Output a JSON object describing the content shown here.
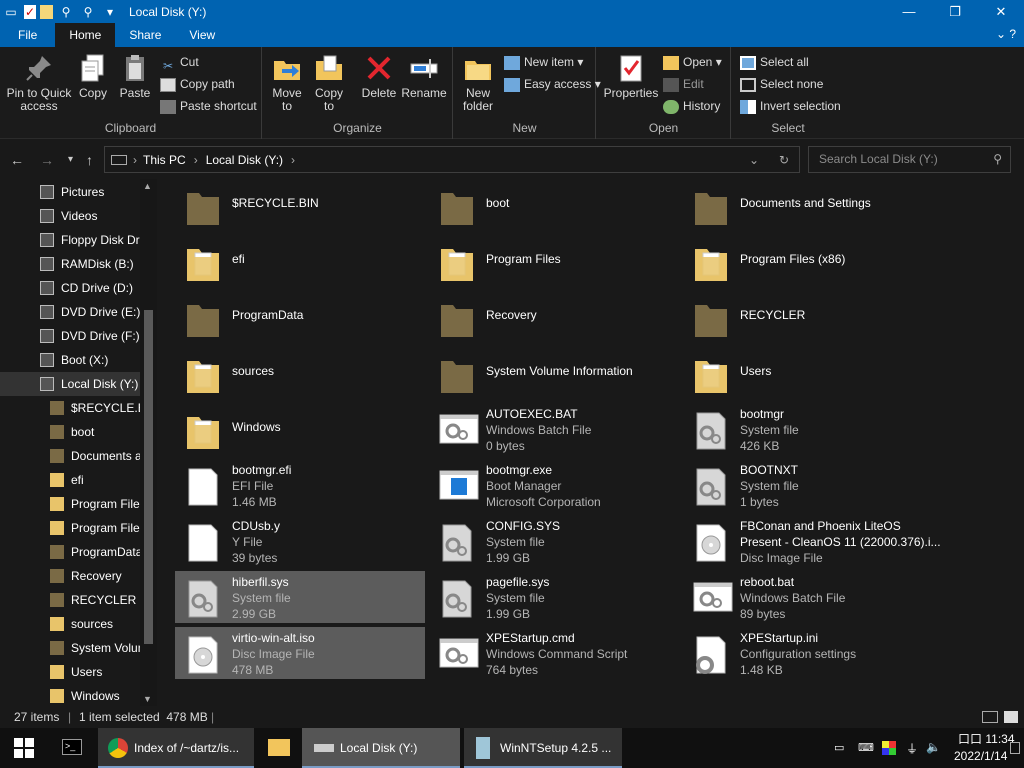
{
  "window": {
    "title": "Local Disk (Y:)"
  },
  "menu": {
    "file": "File",
    "home": "Home",
    "share": "Share",
    "view": "View"
  },
  "ribbon": {
    "clipboard": {
      "label": "Clipboard",
      "pin": "Pin to Quick access",
      "copy": "Copy",
      "paste": "Paste",
      "cut": "Cut",
      "copy_path": "Copy path",
      "paste_shortcut": "Paste shortcut"
    },
    "organize": {
      "label": "Organize",
      "move_to": "Move to",
      "copy_to": "Copy to",
      "delete": "Delete",
      "rename": "Rename"
    },
    "new": {
      "label": "New",
      "new_folder": "New folder",
      "new_item": "New item",
      "easy_access": "Easy access"
    },
    "open": {
      "label": "Open",
      "properties": "Properties",
      "open": "Open",
      "edit": "Edit",
      "history": "History"
    },
    "select": {
      "label": "Select",
      "select_all": "Select all",
      "select_none": "Select none",
      "invert": "Invert selection"
    }
  },
  "address": {
    "root": "This PC",
    "current": "Local Disk (Y:)",
    "search_placeholder": "Search Local Disk (Y:)"
  },
  "nav_pane": [
    {
      "label": "Pictures",
      "icon": "pictures-icon",
      "indent": 0
    },
    {
      "label": "Videos",
      "icon": "videos-icon",
      "indent": 0
    },
    {
      "label": "Floppy Disk Dri",
      "icon": "floppy-icon",
      "indent": 0
    },
    {
      "label": "RAMDisk (B:)",
      "icon": "drive-icon",
      "indent": 0
    },
    {
      "label": "CD Drive (D:)",
      "icon": "cd-drive-icon",
      "indent": 0
    },
    {
      "label": "DVD Drive (E:) \\",
      "icon": "dvd-icon",
      "indent": 0
    },
    {
      "label": "DVD Drive (F:) I",
      "icon": "dvd-icon",
      "indent": 0
    },
    {
      "label": "Boot (X:)",
      "icon": "drive-icon",
      "indent": 0
    },
    {
      "label": "Local Disk (Y:)",
      "icon": "drive-icon",
      "indent": 0,
      "selected": true
    },
    {
      "label": "$RECYCLE.BIN",
      "icon": "folder-dark-icon",
      "indent": 1
    },
    {
      "label": "boot",
      "icon": "folder-dark-icon",
      "indent": 1
    },
    {
      "label": "Documents a",
      "icon": "folder-dark-icon",
      "indent": 1
    },
    {
      "label": "efi",
      "icon": "folder-icon",
      "indent": 1
    },
    {
      "label": "Program Files",
      "icon": "folder-icon",
      "indent": 1
    },
    {
      "label": "Program Files",
      "icon": "folder-icon",
      "indent": 1
    },
    {
      "label": "ProgramData",
      "icon": "folder-dark-icon",
      "indent": 1
    },
    {
      "label": "Recovery",
      "icon": "folder-dark-icon",
      "indent": 1
    },
    {
      "label": "RECYCLER",
      "icon": "folder-dark-icon",
      "indent": 1
    },
    {
      "label": "sources",
      "icon": "folder-icon",
      "indent": 1
    },
    {
      "label": "System Volun",
      "icon": "folder-dark-icon",
      "indent": 1
    },
    {
      "label": "Users",
      "icon": "folder-icon",
      "indent": 1
    },
    {
      "label": "Windows",
      "icon": "folder-icon",
      "indent": 1
    }
  ],
  "files": [
    {
      "name": "$RECYCLE.BIN",
      "kind": "folder-dark"
    },
    {
      "name": "boot",
      "kind": "folder-dark"
    },
    {
      "name": "Documents and Settings",
      "kind": "folder-dark"
    },
    {
      "name": "efi",
      "kind": "folder"
    },
    {
      "name": "Program Files",
      "kind": "folder"
    },
    {
      "name": "Program Files (x86)",
      "kind": "folder"
    },
    {
      "name": "ProgramData",
      "kind": "folder-dark"
    },
    {
      "name": "Recovery",
      "kind": "folder-dark"
    },
    {
      "name": "RECYCLER",
      "kind": "folder-dark"
    },
    {
      "name": "sources",
      "kind": "folder"
    },
    {
      "name": "System Volume Information",
      "kind": "folder-dark"
    },
    {
      "name": "Users",
      "kind": "folder"
    },
    {
      "name": "Windows",
      "kind": "folder"
    },
    {
      "name": "AUTOEXEC.BAT",
      "type": "Windows Batch File",
      "size": "0 bytes",
      "kind": "batch"
    },
    {
      "name": "bootmgr",
      "type": "System file",
      "size": "426 KB",
      "kind": "sys"
    },
    {
      "name": "bootmgr.efi",
      "type": "EFI File",
      "size": "1.46 MB",
      "kind": "doc"
    },
    {
      "name": "bootmgr.exe",
      "type": "Boot Manager",
      "size": "Microsoft Corporation",
      "kind": "exe"
    },
    {
      "name": "BOOTNXT",
      "type": "System file",
      "size": "1 bytes",
      "kind": "sys"
    },
    {
      "name": "CDUsb.y",
      "type": "Y File",
      "size": "39 bytes",
      "kind": "doc"
    },
    {
      "name": "CONFIG.SYS",
      "type": "System file",
      "size": "1.99 GB",
      "kind": "sys"
    },
    {
      "name": "FBConan and Phoenix LiteOS",
      "name2": "Present - CleanOS 11 (22000.376).i...",
      "type": "Disc Image File",
      "kind": "iso"
    },
    {
      "name": "hiberfil.sys",
      "type": "System file",
      "size": "2.99 GB",
      "kind": "sys",
      "selected": true
    },
    {
      "name": "pagefile.sys",
      "type": "System file",
      "size": "1.99 GB",
      "kind": "sys"
    },
    {
      "name": "reboot.bat",
      "type": "Windows Batch File",
      "size": "89 bytes",
      "kind": "batch"
    },
    {
      "name": "virtio-win-alt.iso",
      "type": "Disc Image File",
      "size": "478 MB",
      "kind": "iso",
      "selected": true
    },
    {
      "name": "XPEStartup.cmd",
      "type": "Windows Command Script",
      "size": "764 bytes",
      "kind": "batch"
    },
    {
      "name": "XPEStartup.ini",
      "type": "Configuration settings",
      "size": "1.48 KB",
      "kind": "ini"
    }
  ],
  "status": {
    "count": "27 items",
    "selected": "1 item selected  478 MB"
  },
  "taskbar": {
    "chrome": "Index of /~dartz/is...",
    "explorer": "Local Disk (Y:)",
    "winnt": "WinNTSetup 4.2.5 ...",
    "clock_time": "11:34",
    "clock_prefix": "口口",
    "clock_date": "2022/1/14"
  },
  "colors": {
    "titlebar": "#0063b1",
    "folder": "#e8c46a",
    "folder_dark": "#7a6a45",
    "background": "#191919"
  }
}
